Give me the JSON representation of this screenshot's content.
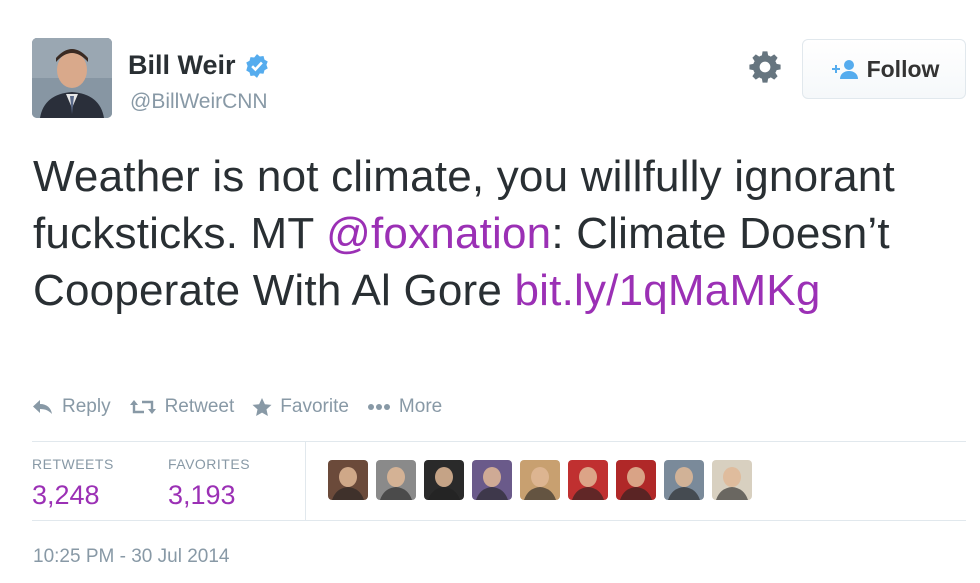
{
  "user": {
    "name": "Bill Weir",
    "handle": "@BillWeirCNN",
    "verified_color": "#55acee"
  },
  "header": {
    "settings_icon": "gear-icon",
    "follow_label": "Follow",
    "follow_icon": "person-plus-icon",
    "accent": "#55acee"
  },
  "tweet": {
    "text_part1": "Weather is not climate, you willfully ignorant fucksticks. MT ",
    "mention": "@foxnation",
    "text_part2": ": Climate Doesn’t Cooperate With Al Gore ",
    "link": "bit.ly/1qMaMKg",
    "link_color": "#9b30b5"
  },
  "actions": {
    "reply": "Reply",
    "retweet": "Retweet",
    "favorite": "Favorite",
    "more": "More"
  },
  "stats": {
    "retweets_label": "RETWEETS",
    "retweets_value": "3,248",
    "favorites_label": "FAVORITES",
    "favorites_value": "3,193"
  },
  "favoriters": [
    {
      "name": "favoriter-1",
      "color": "#6b4a3a"
    },
    {
      "name": "favoriter-2",
      "color": "#8a8a8a"
    },
    {
      "name": "favoriter-3",
      "color": "#2a2a2a"
    },
    {
      "name": "favoriter-4",
      "color": "#6a5a8a"
    },
    {
      "name": "favoriter-5",
      "color": "#c8a070"
    },
    {
      "name": "favoriter-6",
      "color": "#c03030"
    },
    {
      "name": "favoriter-7",
      "color": "#b02828"
    },
    {
      "name": "favoriter-8",
      "color": "#7a8a9a"
    },
    {
      "name": "favoriter-9",
      "color": "#d8d0c0"
    }
  ],
  "timestamp": "10:25 PM - 30 Jul 2014"
}
